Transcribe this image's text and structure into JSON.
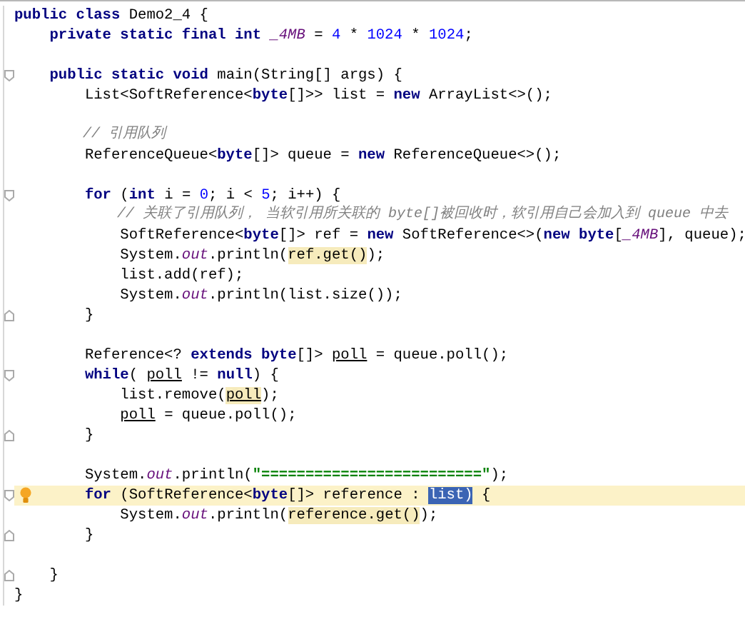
{
  "editor": {
    "lines": [
      {
        "current": false,
        "tokens": [
          {
            "kind": "kw",
            "text": "public class"
          },
          {
            "kind": "text",
            "text": " Demo2_4 {"
          }
        ]
      },
      {
        "current": false,
        "tokens": [
          {
            "kind": "kw",
            "text": "    private static final int "
          },
          {
            "kind": "field",
            "text": "_4MB"
          },
          {
            "kind": "text",
            "text": " = "
          },
          {
            "kind": "num",
            "text": "4"
          },
          {
            "kind": "text",
            "text": " * "
          },
          {
            "kind": "num",
            "text": "1024"
          },
          {
            "kind": "text",
            "text": " * "
          },
          {
            "kind": "num",
            "text": "1024"
          },
          {
            "kind": "text",
            "text": ";"
          }
        ]
      },
      {
        "current": false
      },
      {
        "current": false,
        "fold_marker": {
          "kind": "start"
        },
        "tokens": [
          {
            "kind": "kw",
            "text": "    public static void"
          },
          {
            "kind": "text",
            "text": " main(String[] args) {"
          }
        ]
      },
      {
        "current": false,
        "tokens": [
          {
            "kind": "text",
            "text": "        List<SoftReference<"
          },
          {
            "kind": "kw",
            "text": "byte"
          },
          {
            "kind": "text",
            "text": "[]>> list = "
          },
          {
            "kind": "kw",
            "text": "new"
          },
          {
            "kind": "text",
            "text": " ArrayList<>();"
          }
        ]
      },
      {
        "current": false
      },
      {
        "current": false,
        "tokens": [
          {
            "kind": "comment",
            "text": "        // 引用队列"
          }
        ]
      },
      {
        "current": false,
        "tokens": [
          {
            "kind": "text",
            "text": "        ReferenceQueue<"
          },
          {
            "kind": "kw",
            "text": "byte"
          },
          {
            "kind": "text",
            "text": "[]> queue = "
          },
          {
            "kind": "kw",
            "text": "new"
          },
          {
            "kind": "text",
            "text": " ReferenceQueue<>();"
          }
        ]
      },
      {
        "current": false
      },
      {
        "current": false,
        "fold_marker": {
          "kind": "start"
        },
        "tokens": [
          {
            "kind": "kw",
            "text": "        for"
          },
          {
            "kind": "text",
            "text": " ("
          },
          {
            "kind": "kw",
            "text": "int"
          },
          {
            "kind": "text",
            "text": " i = "
          },
          {
            "kind": "num",
            "text": "0"
          },
          {
            "kind": "text",
            "text": "; i < "
          },
          {
            "kind": "num",
            "text": "5"
          },
          {
            "kind": "text",
            "text": "; i++) {"
          }
        ]
      },
      {
        "current": false,
        "tokens": [
          {
            "kind": "comment",
            "text": "            // 关联了引用队列， 当软引用所关联的 byte[]被回收时，软引用自己会加入到 queue 中去"
          }
        ]
      },
      {
        "current": false,
        "tokens": [
          {
            "kind": "text",
            "text": "            SoftReference<"
          },
          {
            "kind": "kw",
            "text": "byte"
          },
          {
            "kind": "text",
            "text": "[]> ref = "
          },
          {
            "kind": "kw",
            "text": "new"
          },
          {
            "kind": "text",
            "text": " SoftReference<>("
          },
          {
            "kind": "kw",
            "text": "new byte"
          },
          {
            "kind": "text",
            "text": "["
          },
          {
            "kind": "field",
            "text": "_4MB"
          },
          {
            "kind": "text",
            "text": "], queue);"
          }
        ]
      },
      {
        "current": false,
        "tokens": [
          {
            "kind": "text",
            "text": "            System."
          },
          {
            "kind": "field",
            "text": "out"
          },
          {
            "kind": "text",
            "text": ".println("
          },
          {
            "kind": "text",
            "text": "ref.get()",
            "highlight": {
              "kind": "usage"
            }
          },
          {
            "kind": "text",
            "text": ");"
          }
        ]
      },
      {
        "current": false,
        "tokens": [
          {
            "kind": "text",
            "text": "            list.add(ref);"
          }
        ]
      },
      {
        "current": false,
        "tokens": [
          {
            "kind": "text",
            "text": "            System."
          },
          {
            "kind": "field",
            "text": "out"
          },
          {
            "kind": "text",
            "text": ".println(list.size());"
          }
        ]
      },
      {
        "current": false,
        "fold_marker": {
          "kind": "end"
        },
        "tokens": [
          {
            "kind": "text",
            "text": "        }"
          }
        ]
      },
      {
        "current": false
      },
      {
        "current": false,
        "tokens": [
          {
            "kind": "text",
            "text": "        Reference<? "
          },
          {
            "kind": "kw",
            "text": "extends byte"
          },
          {
            "kind": "text",
            "text": "[]> "
          },
          {
            "kind": "var",
            "text": "poll"
          },
          {
            "kind": "text",
            "text": " = queue.poll();"
          }
        ]
      },
      {
        "current": false,
        "fold_marker": {
          "kind": "start"
        },
        "tokens": [
          {
            "kind": "kw",
            "text": "        while"
          },
          {
            "kind": "text",
            "text": "( "
          },
          {
            "kind": "var",
            "text": "poll"
          },
          {
            "kind": "text",
            "text": " != "
          },
          {
            "kind": "kw",
            "text": "null"
          },
          {
            "kind": "text",
            "text": ") {"
          }
        ]
      },
      {
        "current": false,
        "tokens": [
          {
            "kind": "text",
            "text": "            list.remove("
          },
          {
            "kind": "var",
            "text": "poll",
            "highlight": {
              "kind": "usage"
            }
          },
          {
            "kind": "text",
            "text": ");"
          }
        ]
      },
      {
        "current": false,
        "tokens": [
          {
            "kind": "var",
            "text": "            poll"
          },
          {
            "kind": "text",
            "text": " = queue.poll();"
          }
        ]
      },
      {
        "current": false,
        "fold_marker": {
          "kind": "end"
        },
        "tokens": [
          {
            "kind": "text",
            "text": "        }"
          }
        ]
      },
      {
        "current": false
      },
      {
        "current": false,
        "tokens": [
          {
            "kind": "text",
            "text": "        System."
          },
          {
            "kind": "field",
            "text": "out"
          },
          {
            "kind": "text",
            "text": ".println("
          },
          {
            "kind": "string",
            "text": "\"=========================\""
          },
          {
            "kind": "text",
            "text": ");"
          }
        ]
      },
      {
        "current": true,
        "bulb": true,
        "fold_marker": {
          "kind": "start"
        },
        "tokens": [
          {
            "kind": "kw",
            "text": "        for"
          },
          {
            "kind": "text",
            "text": " (SoftReference<"
          },
          {
            "kind": "kw",
            "text": "byte"
          },
          {
            "kind": "text",
            "text": "[]> reference :"
          },
          {
            "kind": "text",
            "text": " list)",
            "highlight": {
              "kind": "selection"
            }
          },
          {
            "kind": "text",
            "text": " {"
          }
        ]
      },
      {
        "current": false,
        "tokens": [
          {
            "kind": "text",
            "text": "            System."
          },
          {
            "kind": "field",
            "text": "out"
          },
          {
            "kind": "text",
            "text": ".println("
          },
          {
            "kind": "text",
            "text": "reference.get()",
            "highlight": {
              "kind": "usage"
            }
          },
          {
            "kind": "text",
            "text": ");"
          }
        ]
      },
      {
        "current": false,
        "fold_marker": {
          "kind": "end"
        },
        "tokens": [
          {
            "kind": "text",
            "text": "        }"
          }
        ]
      },
      {
        "current": false
      },
      {
        "current": false,
        "fold_marker": {
          "kind": "end"
        },
        "tokens": [
          {
            "kind": "text",
            "text": "    }"
          }
        ]
      },
      {
        "current": false,
        "tokens": [
          {
            "kind": "text",
            "text": "}"
          }
        ]
      }
    ]
  }
}
